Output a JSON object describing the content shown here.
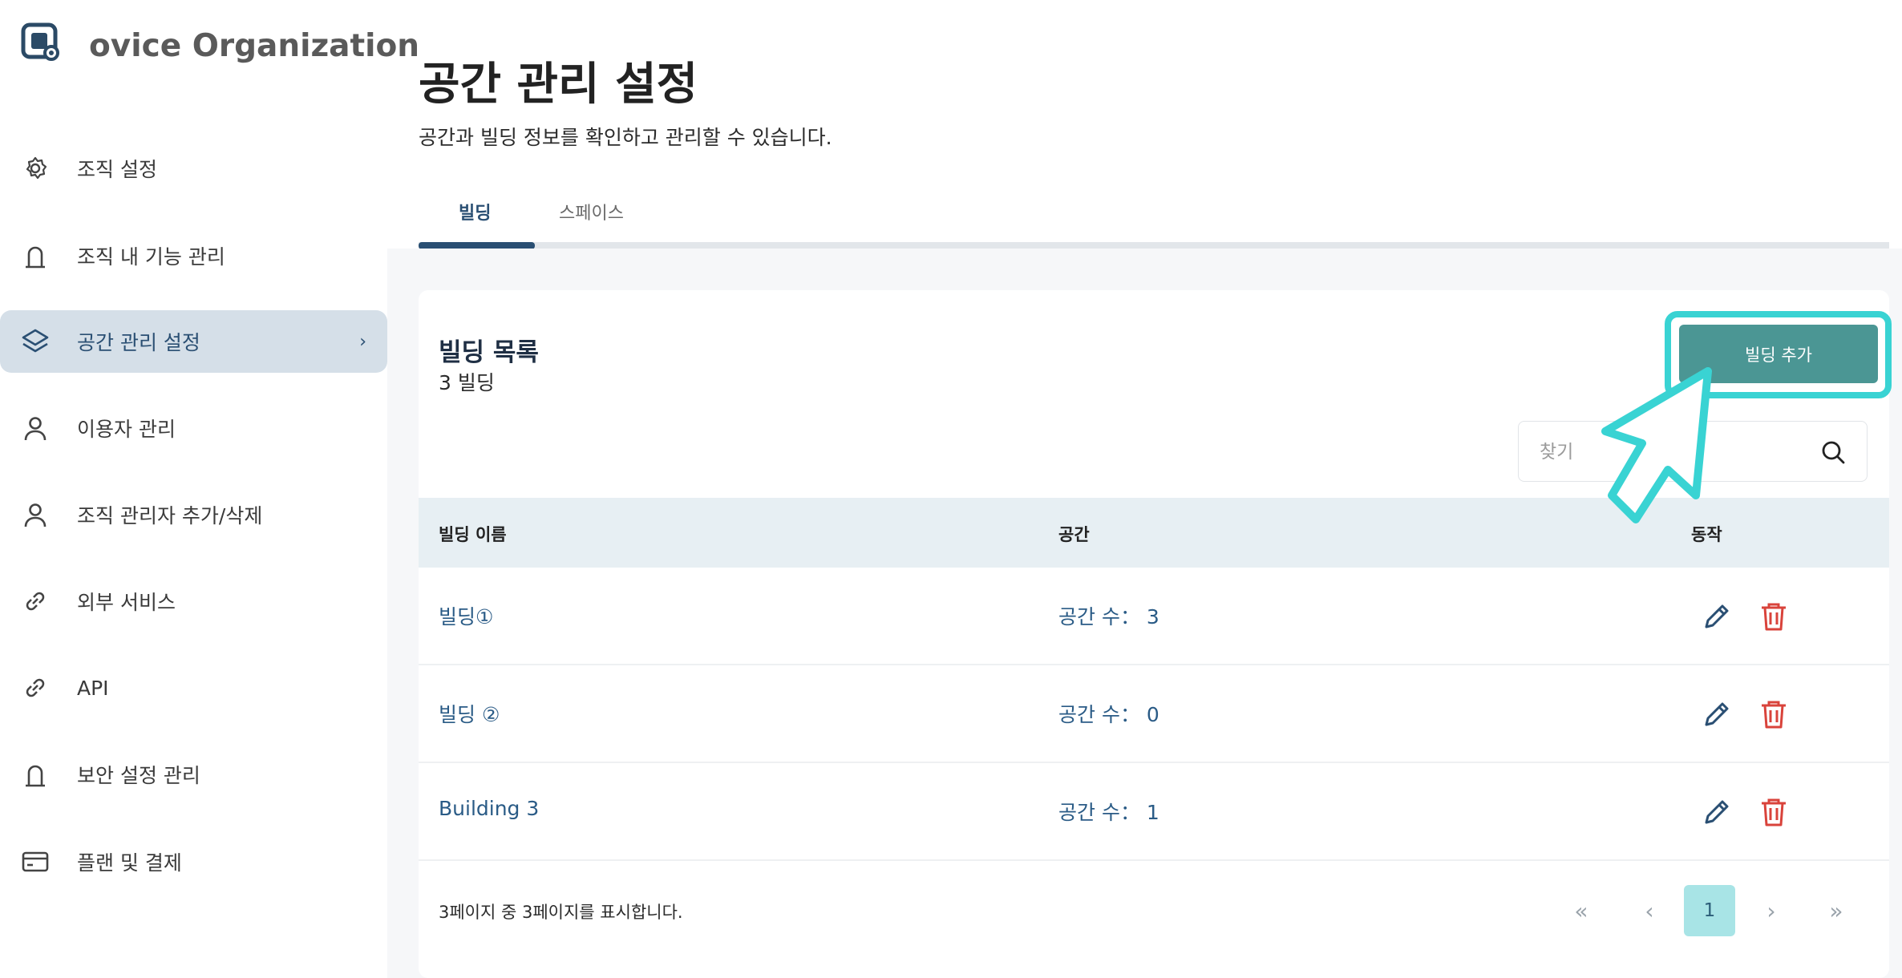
{
  "sidebar": {
    "org_name": "ovice Organization",
    "items": [
      {
        "label": "조직 설정",
        "icon": "gear-icon"
      },
      {
        "label": "조직 내 기능 관리",
        "icon": "lock-icon"
      },
      {
        "label": "공간 관리 설정",
        "icon": "layers-icon",
        "active": true
      },
      {
        "label": "이용자 관리",
        "icon": "user-icon"
      },
      {
        "label": "조직 관리자 추가/삭제",
        "icon": "user-icon"
      },
      {
        "label": "외부 서비스",
        "icon": "link-icon"
      },
      {
        "label": "API",
        "icon": "link-icon"
      },
      {
        "label": "보안 설정 관리",
        "icon": "lock-icon"
      },
      {
        "label": "플랜 및 결제",
        "icon": "credit-card-icon"
      }
    ],
    "active_chevron": "›"
  },
  "header": {
    "title": "공간 관리 설정",
    "subtitle": "공간과 빌딩 정보를 확인하고 관리할 수 있습니다."
  },
  "tabs": [
    {
      "label": "빌딩",
      "selected": true
    },
    {
      "label": "스페이스",
      "selected": false
    }
  ],
  "card": {
    "title": "빌딩 목록",
    "count": "3 빌딩",
    "add_button": "빌딩 추가",
    "search_placeholder": "찾기"
  },
  "table": {
    "headers": [
      "빌딩 이름",
      "공간",
      "동작"
    ],
    "rows": [
      {
        "name": "빌딩①",
        "space": "공간 수： 3"
      },
      {
        "name": "빌딩 ②",
        "space": "공간 수： 0"
      },
      {
        "name": "Building 3",
        "space": "공간 수： 1"
      }
    ]
  },
  "pagination": {
    "summary": "3페이지 중 3페이지를 표시합니다.",
    "first": "«",
    "prev": "‹",
    "current": "1",
    "next": "›",
    "last": "»"
  },
  "colors": {
    "accent": "#2a4f73",
    "add_button": "#4b9694",
    "highlight": "#39d3d3",
    "delete": "#d9433b",
    "active_nav_bg": "#d5dfe8"
  }
}
